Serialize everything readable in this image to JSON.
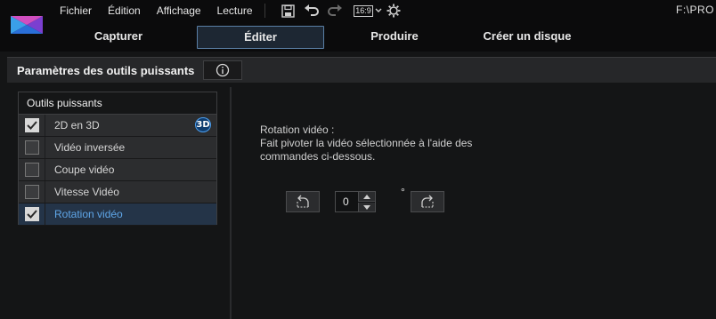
{
  "app": {
    "menu": [
      "Fichier",
      "Édition",
      "Affichage",
      "Lecture"
    ],
    "aspect_ratio": "16:9",
    "path_text": "F:\\PRO"
  },
  "mode_tabs": [
    {
      "label": "Capturer",
      "active": false
    },
    {
      "label": "Éditer",
      "active": true
    },
    {
      "label": "Produire",
      "active": false
    },
    {
      "label": "Créer un disque",
      "active": false
    }
  ],
  "panel": {
    "title": "Paramètres des outils puissants",
    "info_icon": "info-icon"
  },
  "tools": {
    "header": "Outils puissants",
    "items": [
      {
        "label": "2D en 3D",
        "checked": true,
        "badge": "3D"
      },
      {
        "label": "Vidéo inversée",
        "checked": false
      },
      {
        "label": "Coupe vidéo",
        "checked": false
      },
      {
        "label": "Vitesse Vidéo",
        "checked": false
      },
      {
        "label": "Rotation vidéo",
        "checked": true,
        "selected": true
      }
    ]
  },
  "rotation": {
    "title": "Rotation vidéo :",
    "description_line1": "Fait pivoter la vidéo sélectionnée à l'aide des",
    "description_line2": "commandes ci-dessous.",
    "value": "0",
    "unit": "°"
  },
  "colors": {
    "accent": "#5fa6e8",
    "active_tab_border": "#5a7fa6",
    "selected_row": "#243448"
  }
}
